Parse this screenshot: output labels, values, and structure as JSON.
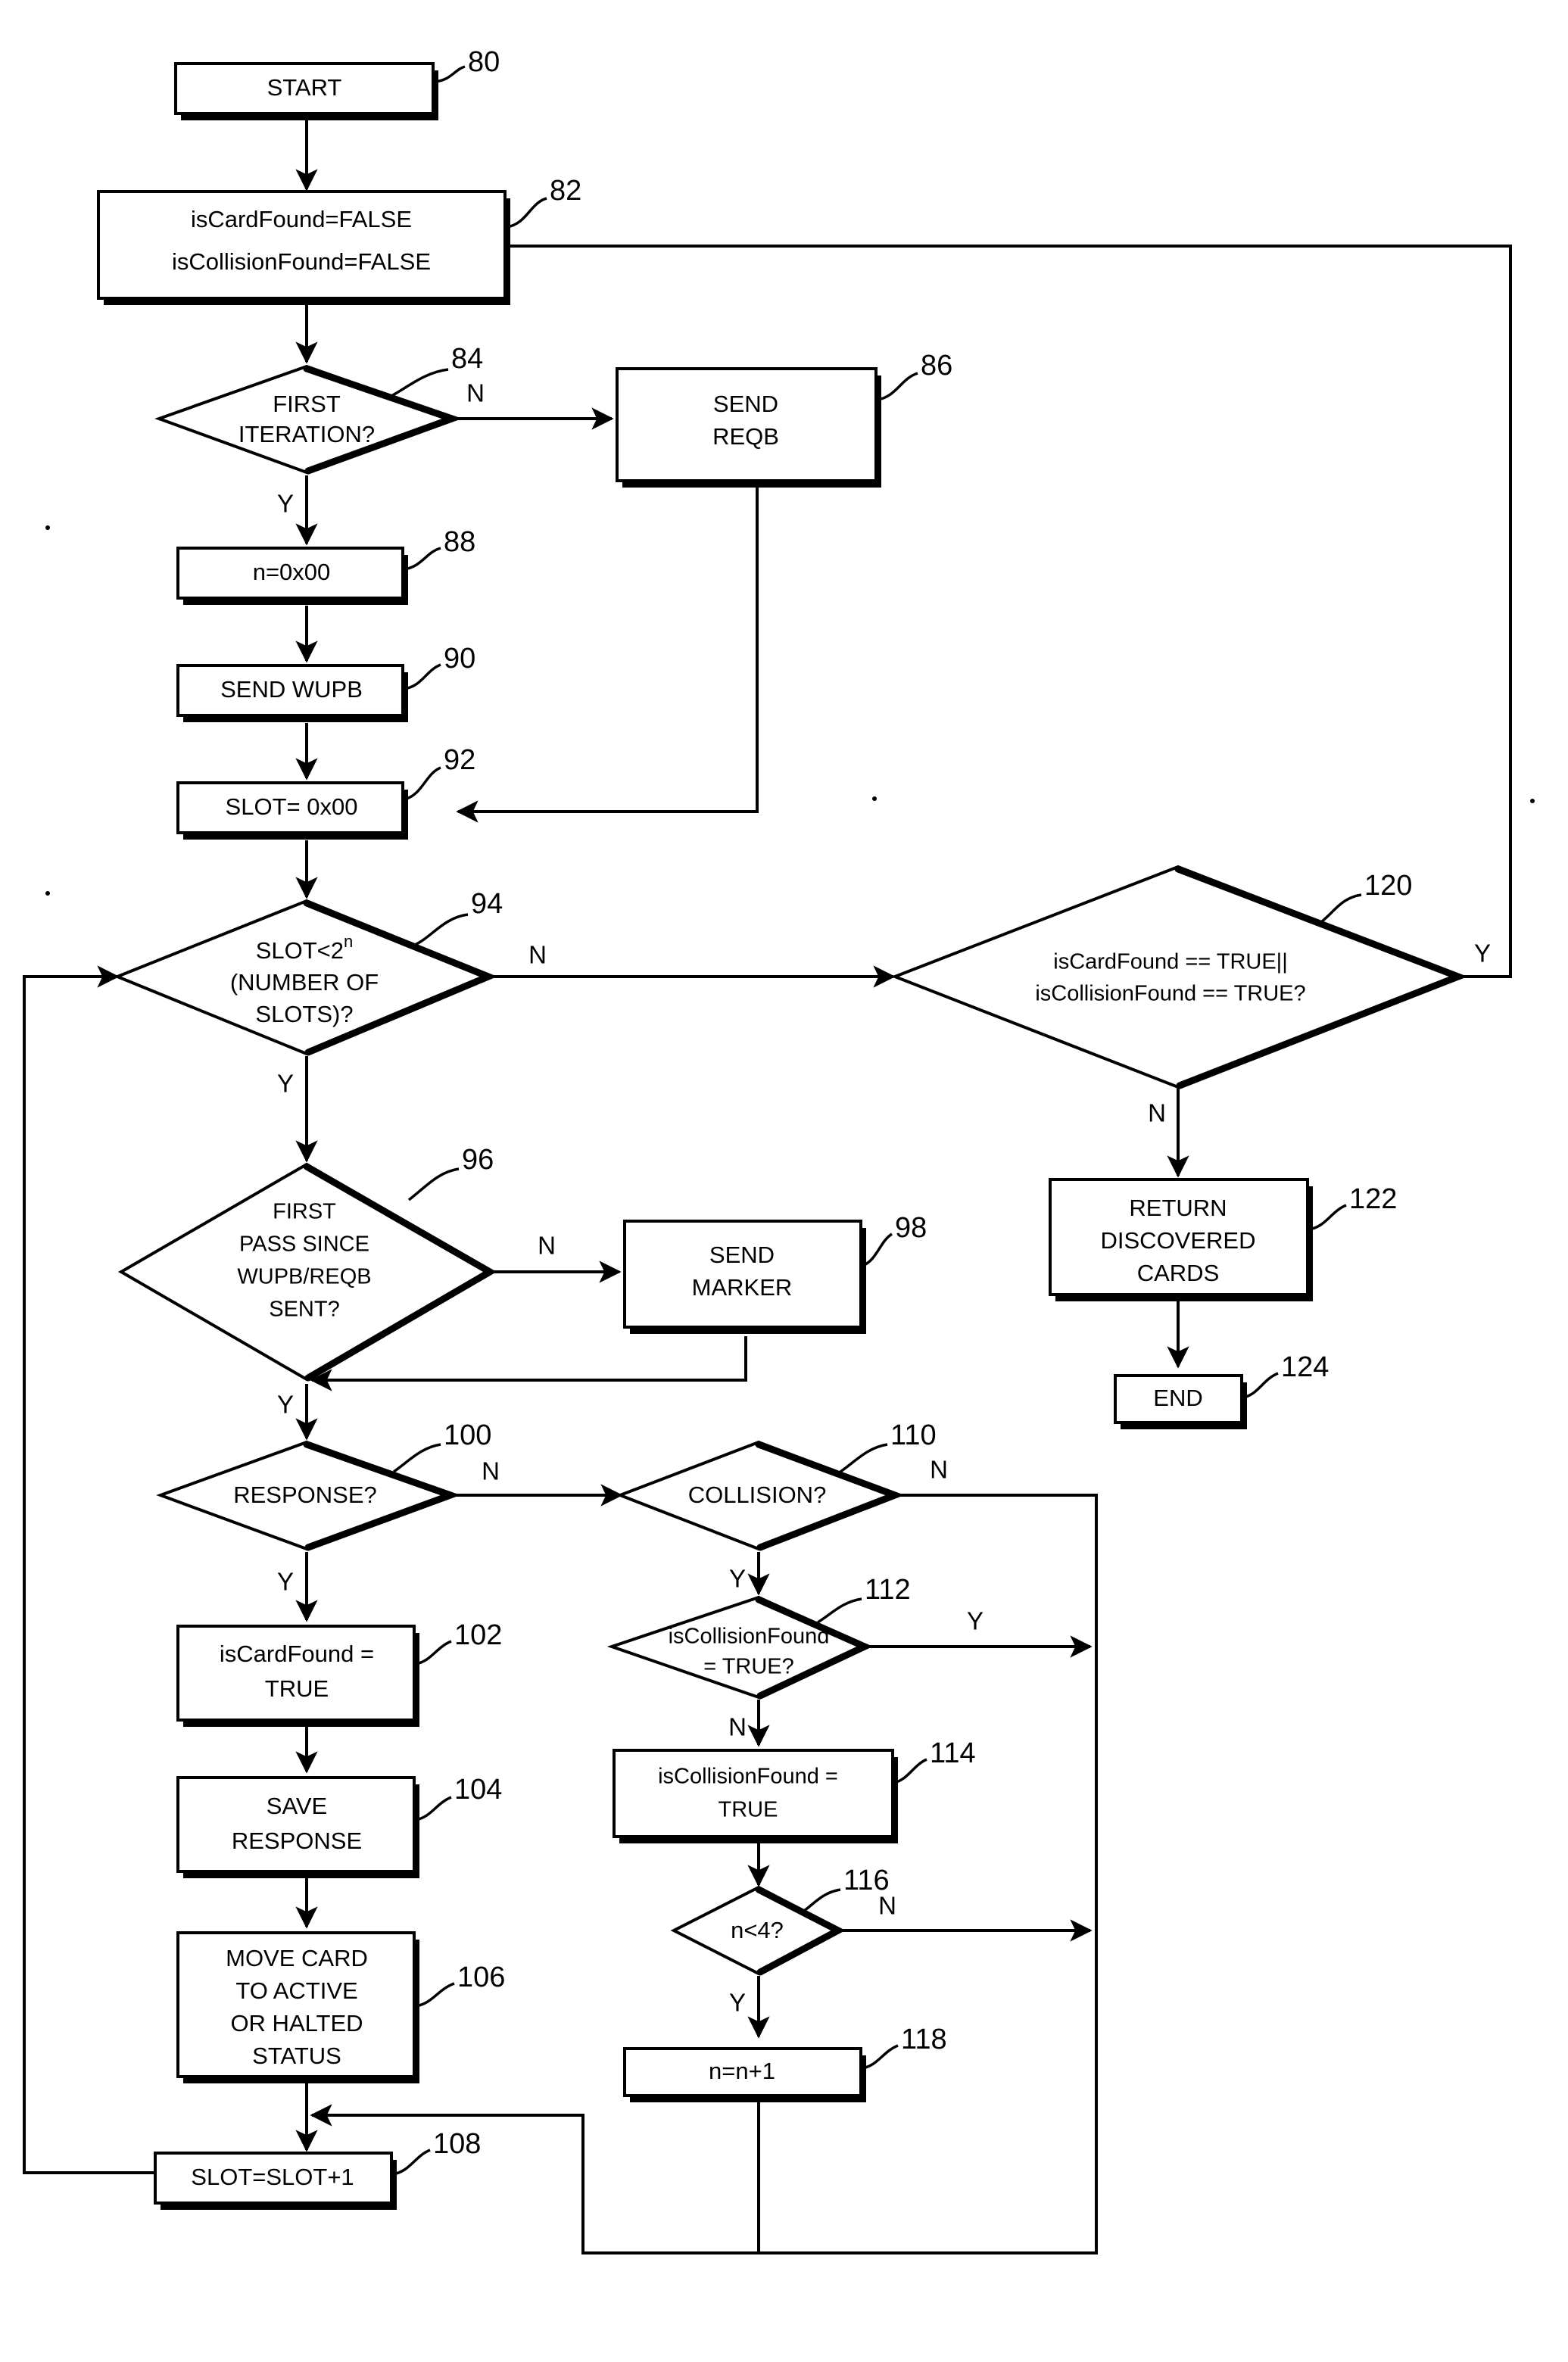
{
  "figure": {
    "type": "patent-flowchart",
    "background": "#ffffff",
    "ink": "#000000"
  },
  "nodes": [
    {
      "id": "n80",
      "ref": "80",
      "shape": "process",
      "lines": [
        "START"
      ]
    },
    {
      "id": "n82",
      "ref": "82",
      "shape": "process",
      "lines": [
        "isCardFound=FALSE",
        "isCollisionFound=FALSE"
      ]
    },
    {
      "id": "n84",
      "ref": "84",
      "shape": "decision",
      "lines": [
        "FIRST",
        "ITERATION?"
      ]
    },
    {
      "id": "n86",
      "ref": "86",
      "shape": "process",
      "lines": [
        "SEND",
        "REQB"
      ]
    },
    {
      "id": "n88",
      "ref": "88",
      "shape": "process",
      "lines": [
        "n=0x00"
      ]
    },
    {
      "id": "n90",
      "ref": "90",
      "shape": "process",
      "lines": [
        "SEND WUPB"
      ]
    },
    {
      "id": "n92",
      "ref": "92",
      "shape": "process",
      "lines": [
        "SLOT= 0x00"
      ]
    },
    {
      "id": "n94",
      "ref": "94",
      "shape": "decision",
      "lines": [
        "SLOT<2^n",
        "(NUMBER OF",
        "SLOTS)?"
      ]
    },
    {
      "id": "n96",
      "ref": "96",
      "shape": "decision",
      "lines": [
        "FIRST",
        "PASS SINCE",
        "WUPB/REQB",
        "SENT?"
      ]
    },
    {
      "id": "n98",
      "ref": "98",
      "shape": "process",
      "lines": [
        "SEND",
        "MARKER"
      ]
    },
    {
      "id": "n100",
      "ref": "100",
      "shape": "decision",
      "lines": [
        "RESPONSE?"
      ]
    },
    {
      "id": "n102",
      "ref": "102",
      "shape": "process",
      "lines": [
        "isCardFound =",
        "TRUE"
      ]
    },
    {
      "id": "n104",
      "ref": "104",
      "shape": "process",
      "lines": [
        "SAVE",
        "RESPONSE"
      ]
    },
    {
      "id": "n106",
      "ref": "106",
      "shape": "process",
      "lines": [
        "MOVE CARD",
        "TO ACTIVE",
        "OR HALTED",
        "STATUS"
      ]
    },
    {
      "id": "n108",
      "ref": "108",
      "shape": "process",
      "lines": [
        "SLOT=SLOT+1"
      ]
    },
    {
      "id": "n110",
      "ref": "110",
      "shape": "decision",
      "lines": [
        "COLLISION?"
      ]
    },
    {
      "id": "n112",
      "ref": "112",
      "shape": "decision",
      "lines": [
        "isCollisionFound",
        "= TRUE?"
      ]
    },
    {
      "id": "n114",
      "ref": "114",
      "shape": "process",
      "lines": [
        "isCollisionFound =",
        "TRUE"
      ]
    },
    {
      "id": "n116",
      "ref": "116",
      "shape": "decision",
      "lines": [
        "n<4?"
      ]
    },
    {
      "id": "n118",
      "ref": "118",
      "shape": "process",
      "lines": [
        "n=n+1"
      ]
    },
    {
      "id": "n120",
      "ref": "120",
      "shape": "decision",
      "lines": [
        "isCardFound == TRUE||",
        "isCollisionFound == TRUE?"
      ]
    },
    {
      "id": "n122",
      "ref": "122",
      "shape": "process",
      "lines": [
        "RETURN",
        "DISCOVERED",
        "CARDS"
      ]
    },
    {
      "id": "n124",
      "ref": "124",
      "shape": "process",
      "lines": [
        "END"
      ]
    }
  ],
  "branch_labels": [
    {
      "id": "b84n",
      "text": "N",
      "from": "n84",
      "to": "n86"
    },
    {
      "id": "b84y",
      "text": "Y",
      "from": "n84",
      "to": "n88"
    },
    {
      "id": "b94n",
      "text": "N",
      "from": "n94",
      "to": "n120"
    },
    {
      "id": "b94y",
      "text": "Y",
      "from": "n94",
      "to": "n96"
    },
    {
      "id": "b96n",
      "text": "N",
      "from": "n96",
      "to": "n98"
    },
    {
      "id": "b96y",
      "text": "Y",
      "from": "n96",
      "to": "n100"
    },
    {
      "id": "b100n",
      "text": "N",
      "from": "n100",
      "to": "n110"
    },
    {
      "id": "b100y",
      "text": "Y",
      "from": "n100",
      "to": "n102"
    },
    {
      "id": "b110n",
      "text": "N",
      "from": "n110",
      "to": "loop"
    },
    {
      "id": "b110y",
      "text": "Y",
      "from": "n110",
      "to": "n112"
    },
    {
      "id": "b112y",
      "text": "Y",
      "from": "n112",
      "to": "loop"
    },
    {
      "id": "b112n",
      "text": "N",
      "from": "n112",
      "to": "n114"
    },
    {
      "id": "b116n",
      "text": "N",
      "from": "n116",
      "to": "loop"
    },
    {
      "id": "b116y",
      "text": "Y",
      "from": "n116",
      "to": "n118"
    },
    {
      "id": "b120y",
      "text": "Y",
      "from": "n120",
      "to": "n82"
    },
    {
      "id": "b120n",
      "text": "N",
      "from": "n120",
      "to": "n122"
    }
  ],
  "text": {
    "n80_l1": "START",
    "n82_l1": "isCardFound=FALSE",
    "n82_l2": "isCollisionFound=FALSE",
    "n84_l1": "FIRST",
    "n84_l2": "ITERATION?",
    "n86_l1": "SEND",
    "n86_l2": "REQB",
    "n88_l1": "n=0x00",
    "n90_l1": "SEND WUPB",
    "n92_l1": "SLOT= 0x00",
    "n94_l1a": "SLOT<2",
    "n94_l1b": "n",
    "n94_l2": "(NUMBER OF",
    "n94_l3": "SLOTS)?",
    "n96_l1": "FIRST",
    "n96_l2": "PASS SINCE",
    "n96_l3": "WUPB/REQB",
    "n96_l4": "SENT?",
    "n98_l1": "SEND",
    "n98_l2": "MARKER",
    "n100_l1": "RESPONSE?",
    "n102_l1": "isCardFound =",
    "n102_l2": "TRUE",
    "n104_l1": "SAVE",
    "n104_l2": "RESPONSE",
    "n106_l1": "MOVE CARD",
    "n106_l2": "TO ACTIVE",
    "n106_l3": "OR HALTED",
    "n106_l4": "STATUS",
    "n108_l1": "SLOT=SLOT+1",
    "n110_l1": "COLLISION?",
    "n112_l1": "isCollisionFound",
    "n112_l2": "= TRUE?",
    "n114_l1": "isCollisionFound =",
    "n114_l2": "TRUE",
    "n116_l1": "n<4?",
    "n118_l1": "n=n+1",
    "n120_l1": "isCardFound == TRUE||",
    "n120_l2": "isCollisionFound == TRUE?",
    "n122_l1": "RETURN",
    "n122_l2": "DISCOVERED",
    "n122_l3": "CARDS",
    "n124_l1": "END"
  },
  "refs": {
    "r80": "80",
    "r82": "82",
    "r84": "84",
    "r86": "86",
    "r88": "88",
    "r90": "90",
    "r92": "92",
    "r94": "94",
    "r96": "96",
    "r98": "98",
    "r100": "100",
    "r102": "102",
    "r104": "104",
    "r106": "106",
    "r108": "108",
    "r110": "110",
    "r112": "112",
    "r114": "114",
    "r116": "116",
    "r118": "118",
    "r120": "120",
    "r122": "122",
    "r124": "124"
  },
  "branches": {
    "b84n": "N",
    "b84y": "Y",
    "b94n": "N",
    "b94y": "Y",
    "b96n": "N",
    "b96y": "Y",
    "b100n": "N",
    "b100y": "Y",
    "b110n": "N",
    "b110y": "Y",
    "b112y": "Y",
    "b112n": "N",
    "b116n": "N",
    "b116y": "Y",
    "b120y": "Y",
    "b120n": "N"
  }
}
